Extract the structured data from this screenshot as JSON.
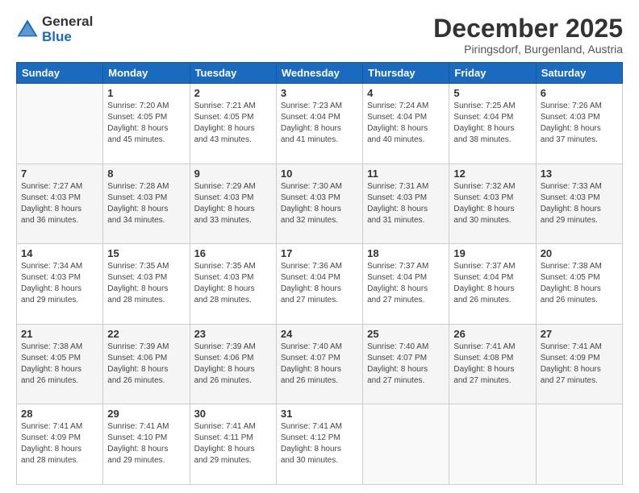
{
  "logo": {
    "general": "General",
    "blue": "Blue"
  },
  "header": {
    "month": "December 2025",
    "location": "Piringsdorf, Burgenland, Austria"
  },
  "weekdays": [
    "Sunday",
    "Monday",
    "Tuesday",
    "Wednesday",
    "Thursday",
    "Friday",
    "Saturday"
  ],
  "weeks": [
    [
      {
        "day": "",
        "info": ""
      },
      {
        "day": "1",
        "info": "Sunrise: 7:20 AM\nSunset: 4:05 PM\nDaylight: 8 hours\nand 45 minutes."
      },
      {
        "day": "2",
        "info": "Sunrise: 7:21 AM\nSunset: 4:05 PM\nDaylight: 8 hours\nand 43 minutes."
      },
      {
        "day": "3",
        "info": "Sunrise: 7:23 AM\nSunset: 4:04 PM\nDaylight: 8 hours\nand 41 minutes."
      },
      {
        "day": "4",
        "info": "Sunrise: 7:24 AM\nSunset: 4:04 PM\nDaylight: 8 hours\nand 40 minutes."
      },
      {
        "day": "5",
        "info": "Sunrise: 7:25 AM\nSunset: 4:04 PM\nDaylight: 8 hours\nand 38 minutes."
      },
      {
        "day": "6",
        "info": "Sunrise: 7:26 AM\nSunset: 4:03 PM\nDaylight: 8 hours\nand 37 minutes."
      }
    ],
    [
      {
        "day": "7",
        "info": "Sunrise: 7:27 AM\nSunset: 4:03 PM\nDaylight: 8 hours\nand 36 minutes."
      },
      {
        "day": "8",
        "info": "Sunrise: 7:28 AM\nSunset: 4:03 PM\nDaylight: 8 hours\nand 34 minutes."
      },
      {
        "day": "9",
        "info": "Sunrise: 7:29 AM\nSunset: 4:03 PM\nDaylight: 8 hours\nand 33 minutes."
      },
      {
        "day": "10",
        "info": "Sunrise: 7:30 AM\nSunset: 4:03 PM\nDaylight: 8 hours\nand 32 minutes."
      },
      {
        "day": "11",
        "info": "Sunrise: 7:31 AM\nSunset: 4:03 PM\nDaylight: 8 hours\nand 31 minutes."
      },
      {
        "day": "12",
        "info": "Sunrise: 7:32 AM\nSunset: 4:03 PM\nDaylight: 8 hours\nand 30 minutes."
      },
      {
        "day": "13",
        "info": "Sunrise: 7:33 AM\nSunset: 4:03 PM\nDaylight: 8 hours\nand 29 minutes."
      }
    ],
    [
      {
        "day": "14",
        "info": "Sunrise: 7:34 AM\nSunset: 4:03 PM\nDaylight: 8 hours\nand 29 minutes."
      },
      {
        "day": "15",
        "info": "Sunrise: 7:35 AM\nSunset: 4:03 PM\nDaylight: 8 hours\nand 28 minutes."
      },
      {
        "day": "16",
        "info": "Sunrise: 7:35 AM\nSunset: 4:03 PM\nDaylight: 8 hours\nand 28 minutes."
      },
      {
        "day": "17",
        "info": "Sunrise: 7:36 AM\nSunset: 4:04 PM\nDaylight: 8 hours\nand 27 minutes."
      },
      {
        "day": "18",
        "info": "Sunrise: 7:37 AM\nSunset: 4:04 PM\nDaylight: 8 hours\nand 27 minutes."
      },
      {
        "day": "19",
        "info": "Sunrise: 7:37 AM\nSunset: 4:04 PM\nDaylight: 8 hours\nand 26 minutes."
      },
      {
        "day": "20",
        "info": "Sunrise: 7:38 AM\nSunset: 4:05 PM\nDaylight: 8 hours\nand 26 minutes."
      }
    ],
    [
      {
        "day": "21",
        "info": "Sunrise: 7:38 AM\nSunset: 4:05 PM\nDaylight: 8 hours\nand 26 minutes."
      },
      {
        "day": "22",
        "info": "Sunrise: 7:39 AM\nSunset: 4:06 PM\nDaylight: 8 hours\nand 26 minutes."
      },
      {
        "day": "23",
        "info": "Sunrise: 7:39 AM\nSunset: 4:06 PM\nDaylight: 8 hours\nand 26 minutes."
      },
      {
        "day": "24",
        "info": "Sunrise: 7:40 AM\nSunset: 4:07 PM\nDaylight: 8 hours\nand 26 minutes."
      },
      {
        "day": "25",
        "info": "Sunrise: 7:40 AM\nSunset: 4:07 PM\nDaylight: 8 hours\nand 27 minutes."
      },
      {
        "day": "26",
        "info": "Sunrise: 7:41 AM\nSunset: 4:08 PM\nDaylight: 8 hours\nand 27 minutes."
      },
      {
        "day": "27",
        "info": "Sunrise: 7:41 AM\nSunset: 4:09 PM\nDaylight: 8 hours\nand 27 minutes."
      }
    ],
    [
      {
        "day": "28",
        "info": "Sunrise: 7:41 AM\nSunset: 4:09 PM\nDaylight: 8 hours\nand 28 minutes."
      },
      {
        "day": "29",
        "info": "Sunrise: 7:41 AM\nSunset: 4:10 PM\nDaylight: 8 hours\nand 29 minutes."
      },
      {
        "day": "30",
        "info": "Sunrise: 7:41 AM\nSunset: 4:11 PM\nDaylight: 8 hours\nand 29 minutes."
      },
      {
        "day": "31",
        "info": "Sunrise: 7:41 AM\nSunset: 4:12 PM\nDaylight: 8 hours\nand 30 minutes."
      },
      {
        "day": "",
        "info": ""
      },
      {
        "day": "",
        "info": ""
      },
      {
        "day": "",
        "info": ""
      }
    ]
  ]
}
